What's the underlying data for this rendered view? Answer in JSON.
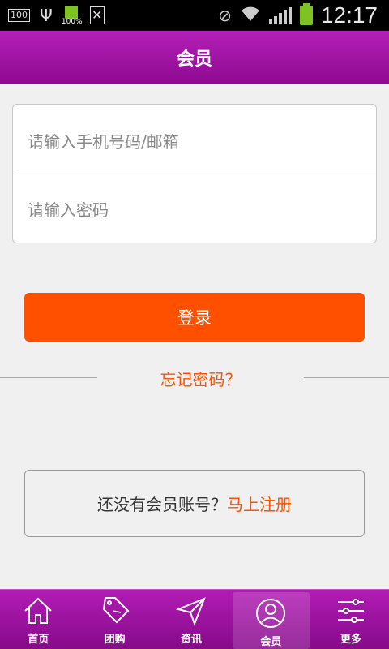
{
  "status_bar": {
    "notification_badge": "100",
    "battery_small_label": "100%",
    "time": "12:17"
  },
  "header": {
    "title": "会员"
  },
  "login_form": {
    "phone_placeholder": "请输入手机号码/邮箱",
    "password_placeholder": "请输入密码",
    "login_button": "登录",
    "forgot_password": "忘记密码？"
  },
  "register": {
    "prompt": "还没有会员账号？",
    "link": "马上注册"
  },
  "tabbar": {
    "items": [
      {
        "label": "首页",
        "icon": "home-icon"
      },
      {
        "label": "团购",
        "icon": "sale-tag-icon"
      },
      {
        "label": "资讯",
        "icon": "paper-plane-icon"
      },
      {
        "label": "会员",
        "icon": "user-icon",
        "active": true
      },
      {
        "label": "更多",
        "icon": "sliders-icon"
      }
    ]
  },
  "colors": {
    "accent": "#ff5000",
    "header_purple": "#a515a9",
    "battery_green": "#7ec224"
  }
}
